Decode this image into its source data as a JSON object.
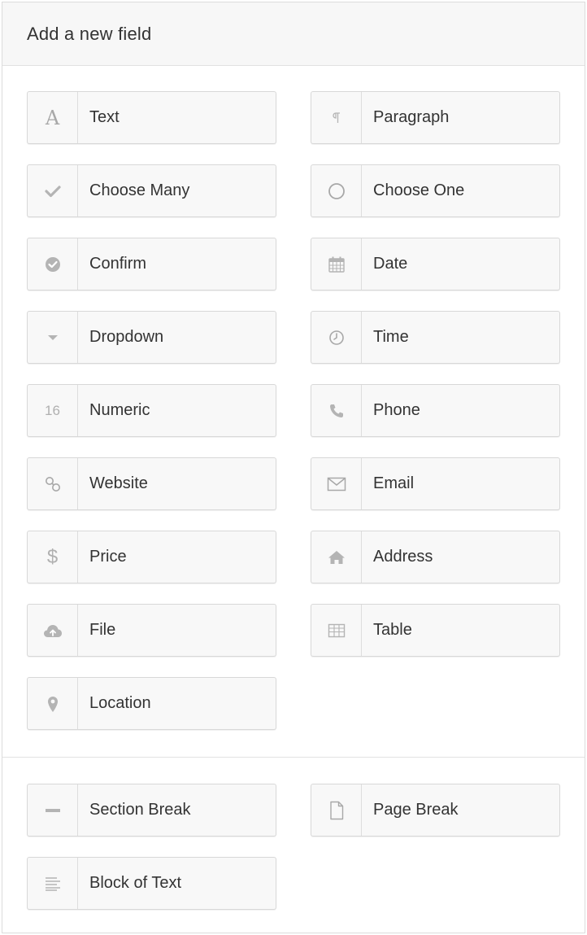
{
  "panel": {
    "title": "Add a new field"
  },
  "fields": [
    {
      "label": "Text",
      "icon": "text-icon"
    },
    {
      "label": "Paragraph",
      "icon": "paragraph-icon"
    },
    {
      "label": "Choose Many",
      "icon": "checkmark-icon"
    },
    {
      "label": "Choose One",
      "icon": "radio-circle-icon"
    },
    {
      "label": "Confirm",
      "icon": "check-circle-icon"
    },
    {
      "label": "Date",
      "icon": "calendar-icon"
    },
    {
      "label": "Dropdown",
      "icon": "caret-down-icon"
    },
    {
      "label": "Time",
      "icon": "clock-icon"
    },
    {
      "label": "Numeric",
      "icon": "number-16-icon",
      "glyph": "16"
    },
    {
      "label": "Phone",
      "icon": "phone-icon"
    },
    {
      "label": "Website",
      "icon": "link-icon"
    },
    {
      "label": "Email",
      "icon": "envelope-icon"
    },
    {
      "label": "Price",
      "icon": "dollar-icon",
      "glyph": "$"
    },
    {
      "label": "Address",
      "icon": "home-icon"
    },
    {
      "label": "File",
      "icon": "cloud-upload-icon"
    },
    {
      "label": "Table",
      "icon": "table-icon"
    },
    {
      "label": "Location",
      "icon": "map-pin-icon"
    }
  ],
  "layout_fields": [
    {
      "label": "Section Break",
      "icon": "horizontal-rule-icon"
    },
    {
      "label": "Page Break",
      "icon": "page-icon"
    },
    {
      "label": "Block of Text",
      "icon": "text-block-icon"
    }
  ],
  "colors": {
    "icon": "#b4b4b4",
    "text": "#333333",
    "button_bg": "#f8f8f8",
    "border": "#d8d8d8",
    "header_bg": "#f7f7f7"
  }
}
